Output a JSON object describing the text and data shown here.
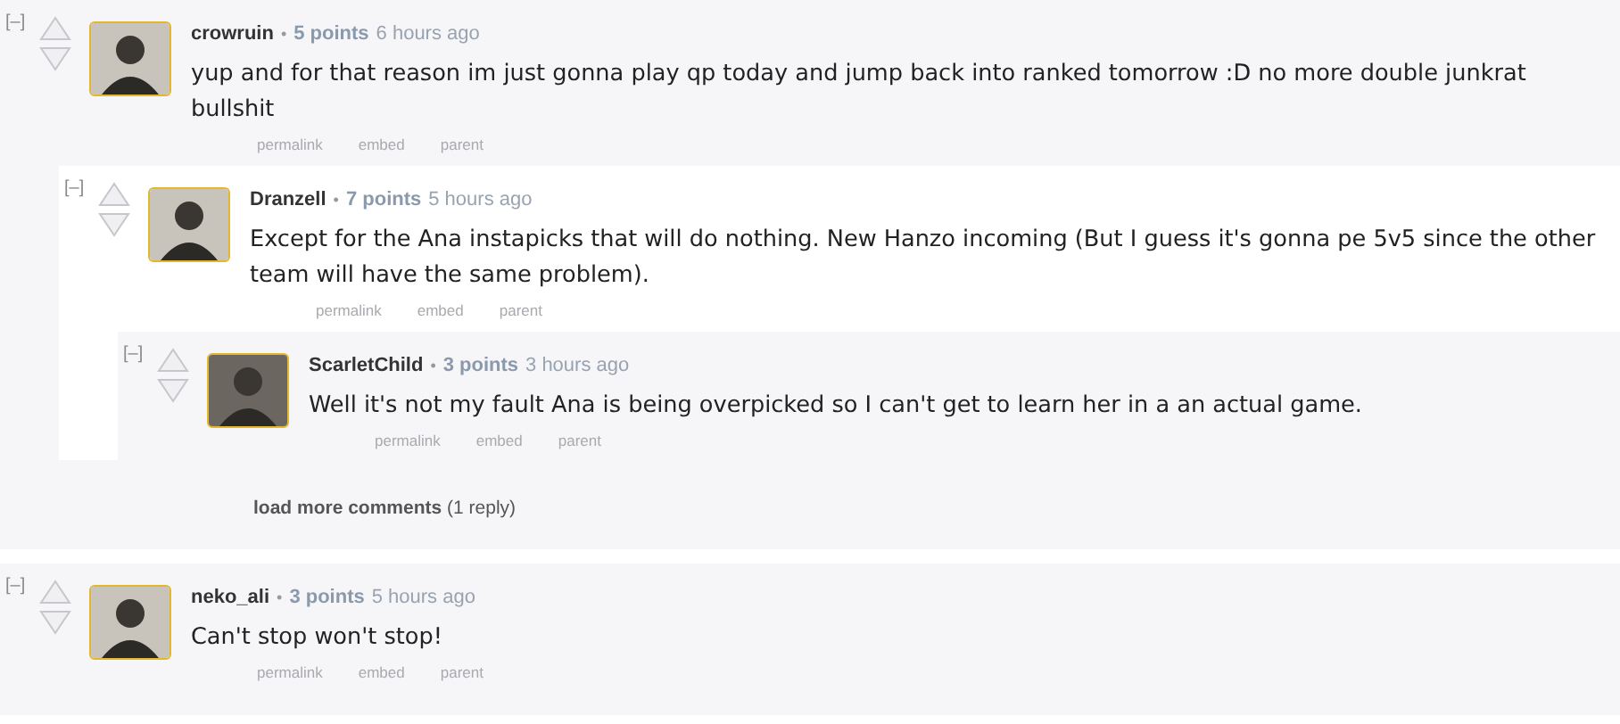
{
  "comments": [
    {
      "collapse": "[–]",
      "author": "crowruin",
      "separator": "•",
      "score": "5 points",
      "time": "6 hours ago",
      "body": "yup and for that reason im just gonna play qp today and jump back into ranked tomorrow :D no more double junkrat bullshit",
      "actions": [
        "permalink",
        "embed",
        "parent"
      ],
      "load_more": "**load more comments** (1 reply)",
      "children": [
        {
          "collapse": "[–]",
          "author": "Dranzell",
          "separator": "•",
          "score": "7 points",
          "time": "5 hours ago",
          "body": "Except for the Ana instapicks that will do nothing. New Hanzo incoming (But I guess it's gonna pe 5v5 since the other team will have the same problem).",
          "actions": [
            "permalink",
            "embed",
            "parent"
          ],
          "children": [
            {
              "collapse": "[–]",
              "author": "ScarletChild",
              "separator": "•",
              "score": "3 points",
              "time": "3 hours ago",
              "body": "Well it's not my fault Ana is being overpicked so I can't get to learn her in a an actual game.",
              "actions": [
                "permalink",
                "embed",
                "parent"
              ]
            }
          ]
        }
      ]
    },
    {
      "collapse": "[–]",
      "author": "neko_ali",
      "separator": "•",
      "score": "3 points",
      "time": "5 hours ago",
      "body": "Can't stop won't stop!",
      "actions": [
        "permalink",
        "embed",
        "parent"
      ]
    }
  ]
}
